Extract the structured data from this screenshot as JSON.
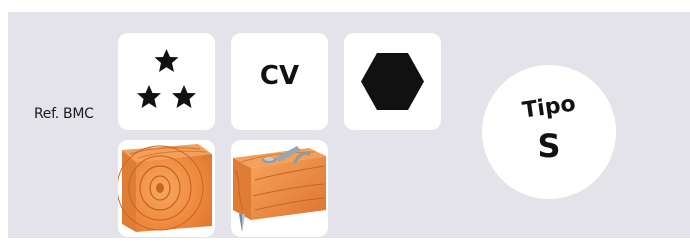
{
  "reference": {
    "label": "Ref. BMC"
  },
  "icons": {
    "stars": "three-stars-icon",
    "cv_text": "CV",
    "hex": "hexagon-head-icon",
    "wood_plain": "wood-block-icon",
    "wood_nails": "wood-block-nails-icon"
  },
  "type_badge": {
    "word": "Tipo",
    "letter": "S"
  },
  "colors": {
    "panel_bg": "#e4e3ea",
    "tile_bg": "#ffffff",
    "icon_black": "#111111",
    "wood_orange": "#ee8a3c"
  }
}
